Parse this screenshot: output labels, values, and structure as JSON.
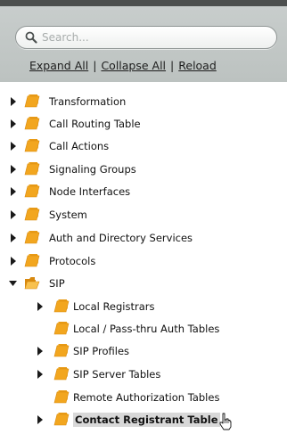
{
  "search": {
    "placeholder": "Search..."
  },
  "toolbar": {
    "expand_all": "Expand All",
    "collapse_all": "Collapse All",
    "reload": "Reload",
    "separator": "|"
  },
  "tree": {
    "items": [
      {
        "label": "Transformation",
        "state": "collapsed",
        "level": 0
      },
      {
        "label": "Call Routing Table",
        "state": "collapsed",
        "level": 0
      },
      {
        "label": "Call Actions",
        "state": "collapsed",
        "level": 0
      },
      {
        "label": "Signaling Groups",
        "state": "collapsed",
        "level": 0
      },
      {
        "label": "Node Interfaces",
        "state": "collapsed",
        "level": 0
      },
      {
        "label": "System",
        "state": "collapsed",
        "level": 0
      },
      {
        "label": "Auth and Directory Services",
        "state": "collapsed",
        "level": 0
      },
      {
        "label": "Protocols",
        "state": "collapsed",
        "level": 0
      },
      {
        "label": "SIP",
        "state": "expanded",
        "level": 0
      },
      {
        "label": "Local Registrars",
        "state": "collapsed",
        "level": 1
      },
      {
        "label": "Local / Pass-thru Auth Tables",
        "state": "leaf",
        "level": 1
      },
      {
        "label": "SIP Profiles",
        "state": "collapsed",
        "level": 1
      },
      {
        "label": "SIP Server Tables",
        "state": "collapsed",
        "level": 1
      },
      {
        "label": "Remote Authorization Tables",
        "state": "leaf",
        "level": 1
      },
      {
        "label": "Contact Registrant Table",
        "state": "collapsed",
        "level": 1,
        "selected": true
      }
    ]
  },
  "colors": {
    "panel": "#c4c9c8",
    "folder": "#f2a61f",
    "folder_dark": "#d8890f",
    "selected_bg": "#d8d8d8"
  }
}
